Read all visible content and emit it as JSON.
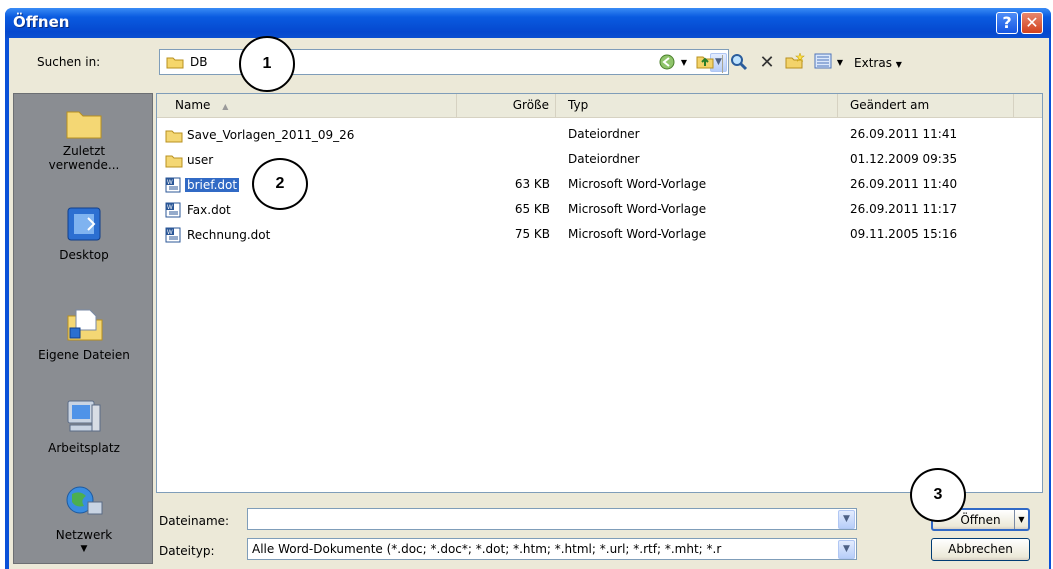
{
  "window": {
    "title": "Öffnen"
  },
  "titlebar": {
    "help_glyph": "?",
    "close_glyph": "✕"
  },
  "lookin": {
    "label": "Suchen in:",
    "value": "DB"
  },
  "toolbar": {
    "extras_label": "Extras",
    "icons": [
      "back-icon",
      "up-folder-icon",
      "search-web-icon",
      "delete-icon",
      "new-folder-icon",
      "views-icon"
    ]
  },
  "places": [
    {
      "label_line1": "Zuletzt",
      "label_line2": "verwende..."
    },
    {
      "label_line1": "Desktop",
      "label_line2": ""
    },
    {
      "label_line1": "Eigene Dateien",
      "label_line2": ""
    },
    {
      "label_line1": "Arbeitsplatz",
      "label_line2": ""
    },
    {
      "label_line1": "Netzwerk",
      "label_line2": ""
    }
  ],
  "columns": {
    "name": "Name",
    "size": "Größe",
    "type": "Typ",
    "modified": "Geändert am"
  },
  "files": [
    {
      "name": "Save_Vorlagen_2011_09_26",
      "size": "",
      "type": "Dateiordner",
      "modified": "26.09.2011 11:41",
      "kind": "folder"
    },
    {
      "name": "user",
      "size": "",
      "type": "Dateiordner",
      "modified": "01.12.2009 09:35",
      "kind": "folder"
    },
    {
      "name": "brief.dot",
      "size": "63 KB",
      "type": "Microsoft Word-Vorlage",
      "modified": "26.09.2011 11:40",
      "kind": "word"
    },
    {
      "name": "Fax.dot",
      "size": "65 KB",
      "type": "Microsoft Word-Vorlage",
      "modified": "26.09.2011 11:17",
      "kind": "word"
    },
    {
      "name": "Rechnung.dot",
      "size": "75 KB",
      "type": "Microsoft Word-Vorlage",
      "modified": "09.11.2005 15:16",
      "kind": "word"
    }
  ],
  "filename": {
    "label": "Dateiname:",
    "value": ""
  },
  "filetype": {
    "label": "Dateityp:",
    "value": "Alle Word-Dokumente (*.doc; *.doc*; *.dot; *.htm; *.html; *.url; *.rtf; *.mht; *.r"
  },
  "buttons": {
    "open": "Öffnen",
    "cancel": "Abbrechen"
  },
  "callouts": [
    "1",
    "2",
    "3"
  ],
  "colors": {
    "titlebar": "#0548cf",
    "selection": "#316ac5",
    "dialog_bg": "#ece9d8",
    "places_bg": "#8a8d92"
  }
}
